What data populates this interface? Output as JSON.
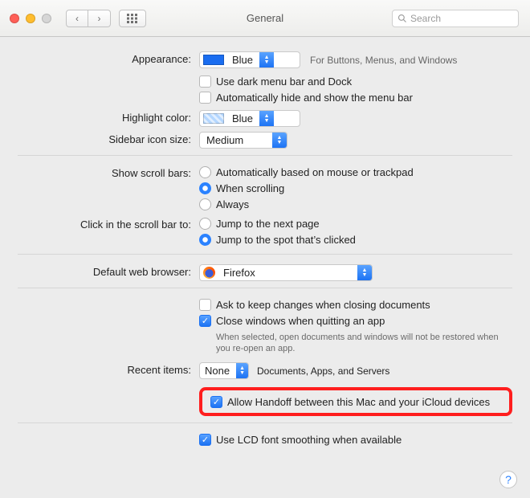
{
  "window": {
    "title": "General"
  },
  "search": {
    "placeholder": "Search"
  },
  "appearance": {
    "label": "Appearance:",
    "value": "Blue",
    "hint": "For Buttons, Menus, and Windows",
    "darkMenu": {
      "label": "Use dark menu bar and Dock",
      "checked": false
    },
    "autoHide": {
      "label": "Automatically hide and show the menu bar",
      "checked": false
    }
  },
  "highlight": {
    "label": "Highlight color:",
    "value": "Blue"
  },
  "sidebar": {
    "label": "Sidebar icon size:",
    "value": "Medium"
  },
  "scrollbars": {
    "label": "Show scroll bars:",
    "opts": {
      "auto": {
        "label": "Automatically based on mouse or trackpad",
        "selected": false
      },
      "scroll": {
        "label": "When scrolling",
        "selected": true
      },
      "always": {
        "label": "Always",
        "selected": false
      }
    }
  },
  "clickScroll": {
    "label": "Click in the scroll bar to:",
    "opts": {
      "page": {
        "label": "Jump to the next page",
        "selected": false
      },
      "spot": {
        "label": "Jump to the spot that’s clicked",
        "selected": true
      }
    }
  },
  "browser": {
    "label": "Default web browser:",
    "value": "Firefox"
  },
  "docs": {
    "ask": {
      "label": "Ask to keep changes when closing documents",
      "checked": false
    },
    "close": {
      "label": "Close windows when quitting an app",
      "checked": true
    },
    "note": "When selected, open documents and windows will not be restored when you re-open an app."
  },
  "recent": {
    "label": "Recent items:",
    "value": "None",
    "suffix": "Documents, Apps, and Servers"
  },
  "handoff": {
    "label": "Allow Handoff between this Mac and your iCloud devices",
    "checked": true
  },
  "lcd": {
    "label": "Use LCD font smoothing when available",
    "checked": true
  }
}
